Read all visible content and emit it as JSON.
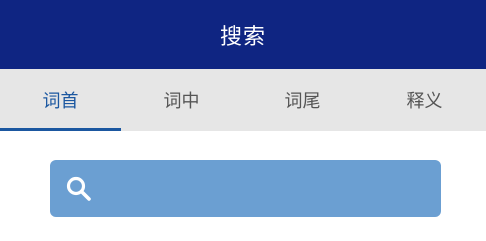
{
  "header": {
    "title": "搜索"
  },
  "tabs": [
    {
      "label": "词首"
    },
    {
      "label": "词中"
    },
    {
      "label": "词尾"
    },
    {
      "label": "释义"
    }
  ],
  "active_tab": "词首",
  "search": {
    "value": "",
    "placeholder": "",
    "icon": "search-icon"
  },
  "colors": {
    "header_bg": "#0f2582",
    "tabs_bg": "#e6e6e6",
    "active_tab": "#1b57a0",
    "inactive_tab": "#555555",
    "search_bg": "#6b9fd2"
  }
}
